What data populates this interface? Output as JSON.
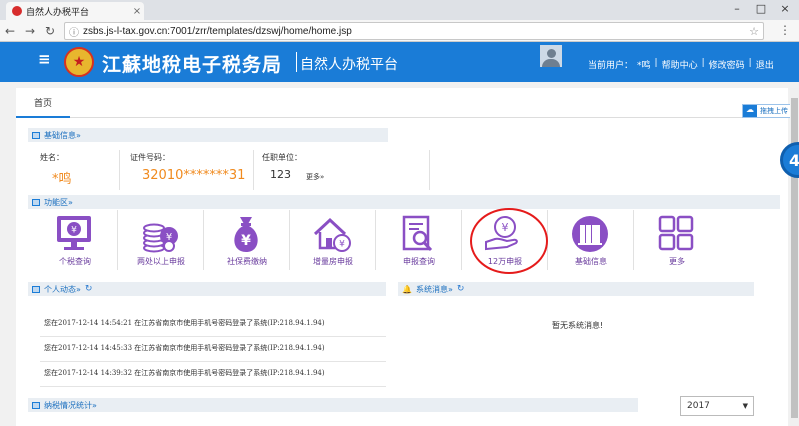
{
  "browser": {
    "tab_title": "自然人办税平台",
    "tab_close": "×",
    "url": "zsbs.js-l-tax.gov.cn:7001/zrr/templates/dzswj/home/home.jsp",
    "win_min": "–",
    "win_max": "□",
    "win_close": "×"
  },
  "header": {
    "hamburger": "≡",
    "brand": "江蘇地稅电子税务局",
    "subtitle": "自然人办税平台",
    "current_user_label": "当前用户：",
    "current_user": "*鸣",
    "sep": "|",
    "help_center": "帮助中心",
    "change_password": "修改密码",
    "logout": "退出"
  },
  "tabs": [
    {
      "label": "首页"
    }
  ],
  "basic_info": {
    "title": "基础信息»",
    "name_label": "姓名：",
    "name_value": "*鸣",
    "id_label": "证件号码：",
    "id_value": "32010*******31",
    "employer_label": "任职单位：",
    "employer_value": "123",
    "more": "更多»"
  },
  "functions": {
    "title": "功能区»",
    "items": [
      {
        "label": "个税查询",
        "icon": "monitor-yuan-icon"
      },
      {
        "label": "两处以上申报",
        "icon": "coin-stack-icon"
      },
      {
        "label": "社保费缴纳",
        "icon": "money-bag-icon"
      },
      {
        "label": "增量房申报",
        "icon": "house-yuan-icon"
      },
      {
        "label": "申报查询",
        "icon": "document-search-icon"
      },
      {
        "label": "12万申报",
        "icon": "hand-yuan-icon"
      },
      {
        "label": "基础信息",
        "icon": "books-icon"
      },
      {
        "label": "更多",
        "icon": "grid-icon"
      }
    ]
  },
  "personal": {
    "title": "个人动态»",
    "messages": [
      {
        "text": "您在2017-12-14 14:54:21 在江苏省南京市使用手机号密码登录了系统(IP:218.94.1.94)"
      },
      {
        "text": "您在2017-12-14 14:45:33 在江苏省南京市使用手机号密码登录了系统(IP:218.94.1.94)"
      },
      {
        "text": "您在2017-12-14 14:39:32 在江苏省南京市使用手机号密码登录了系统(IP:218.94.1.94)"
      }
    ]
  },
  "system": {
    "title": "系统消息»",
    "empty": "暂无系统消息!"
  },
  "stats": {
    "title": "纳税情况统计»",
    "year": "2017"
  },
  "side": {
    "upload": "拖拽上传",
    "badge": "4"
  },
  "colors": {
    "header_blue": "#1a7cd7",
    "purple": "#8a4fc4",
    "orange": "#f08a1e",
    "ring_red": "#e51b1b"
  }
}
